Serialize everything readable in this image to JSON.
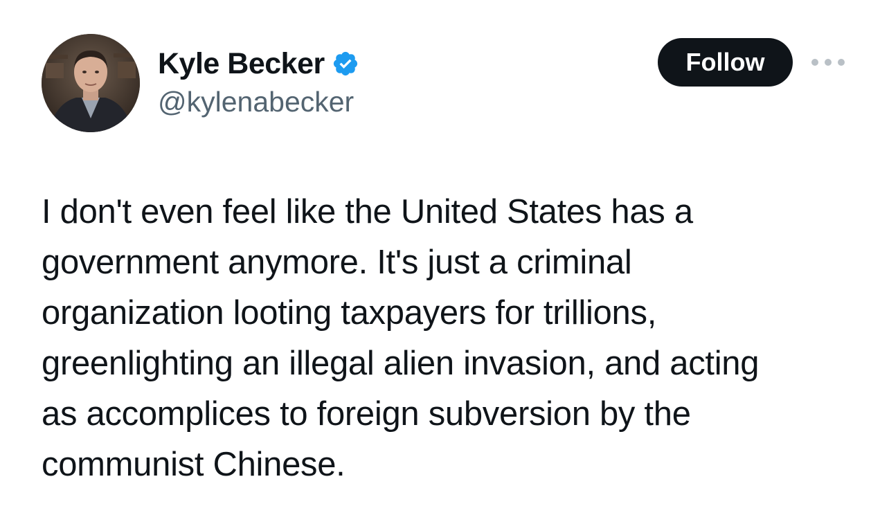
{
  "author": {
    "display_name": "Kyle Becker",
    "handle": "@kylenabecker",
    "verified": true,
    "verified_color": "#1d9bf0",
    "avatar_icon": "profile-photo"
  },
  "actions": {
    "follow_label": "Follow",
    "more_icon": "more-horizontal-icon"
  },
  "tweet": {
    "lines": [
      "I don't even feel like the United States has a",
      "government anymore. It's just a criminal",
      "organization looting taxpayers for trillions,",
      "greenlighting an illegal alien invasion, and acting",
      "as accomplices to foreign subversion by the",
      "communist Chinese."
    ]
  },
  "colors": {
    "text": "#0f1419",
    "secondary_text": "#536471",
    "follow_bg": "#0f1419",
    "follow_text": "#ffffff"
  }
}
